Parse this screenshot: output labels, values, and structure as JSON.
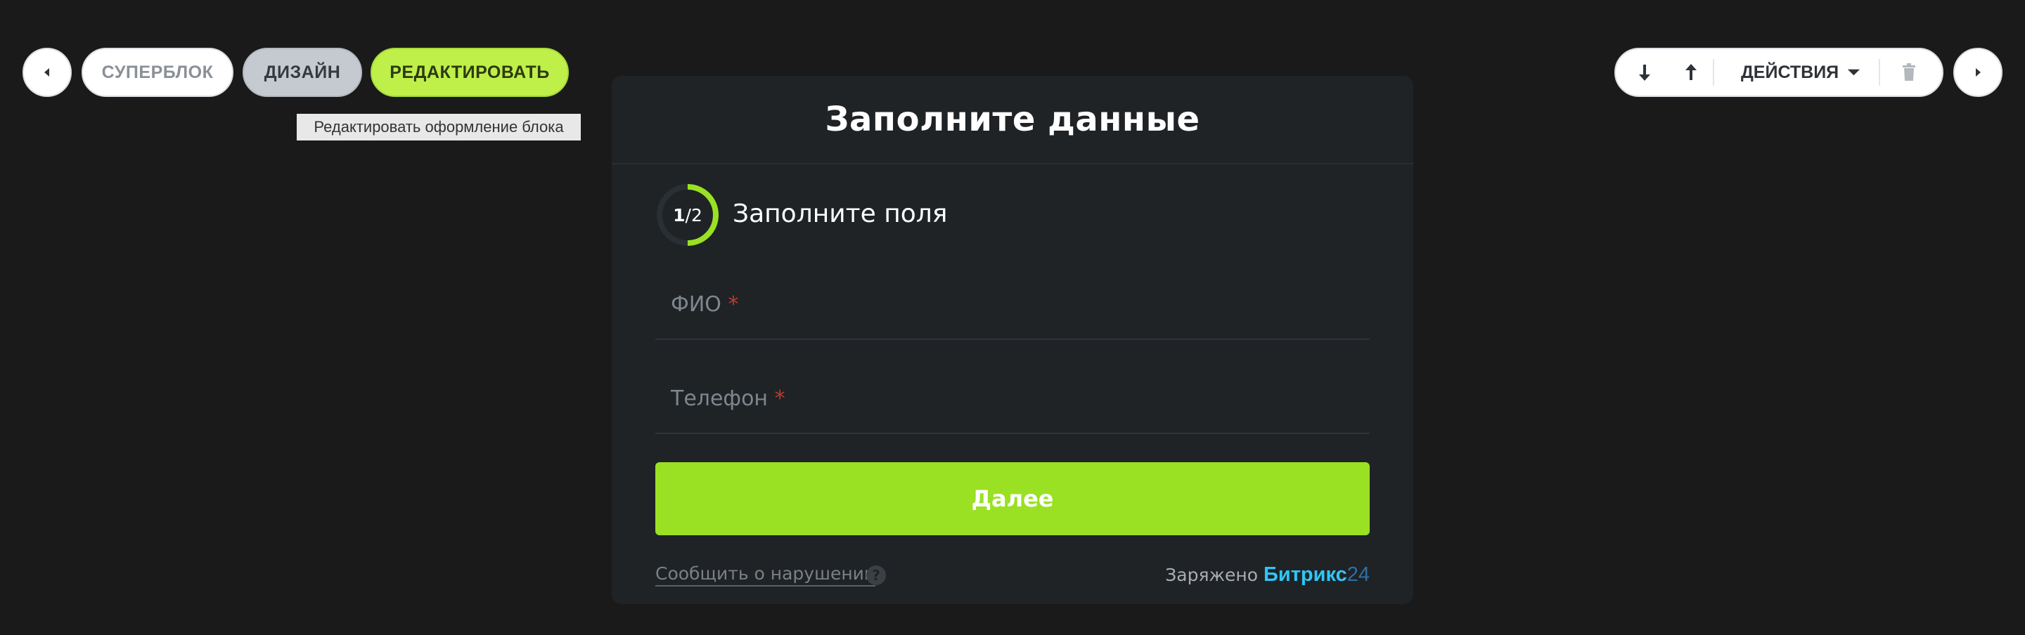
{
  "toolbar_left": {
    "superblock_label": "СУПЕРБЛОК",
    "design_label": "ДИЗАЙН",
    "edit_label": "РЕДАКТИРОВАТЬ",
    "tooltip": "Редактировать оформление блока"
  },
  "toolbar_right": {
    "actions_label": "ДЕЙСТВИЯ"
  },
  "form": {
    "title": "Заполните данные",
    "step_current": "1",
    "step_total": "/2",
    "step_progress": 0.5,
    "step_title": "Заполните поля",
    "fields": [
      {
        "label": "ФИО",
        "required_mark": "*"
      },
      {
        "label": "Телефон",
        "required_mark": "*"
      }
    ],
    "next_label": "Далее",
    "report_label": "Сообщить о нарушении",
    "help_glyph": "?",
    "powered_label": "Заряжено",
    "brand_name": "Битрикс",
    "brand_number": "24"
  },
  "colors": {
    "background": "#1a1a1a",
    "card": "#1f2326",
    "accent": "#9ae123",
    "edit_pill": "#bff049",
    "brand_blue": "#2fc6f6"
  },
  "icons": [
    "arrow-left-icon",
    "arrow-right-icon",
    "move-down-icon",
    "move-up-icon",
    "dropdown-caret-icon",
    "trash-icon",
    "help-icon"
  ]
}
